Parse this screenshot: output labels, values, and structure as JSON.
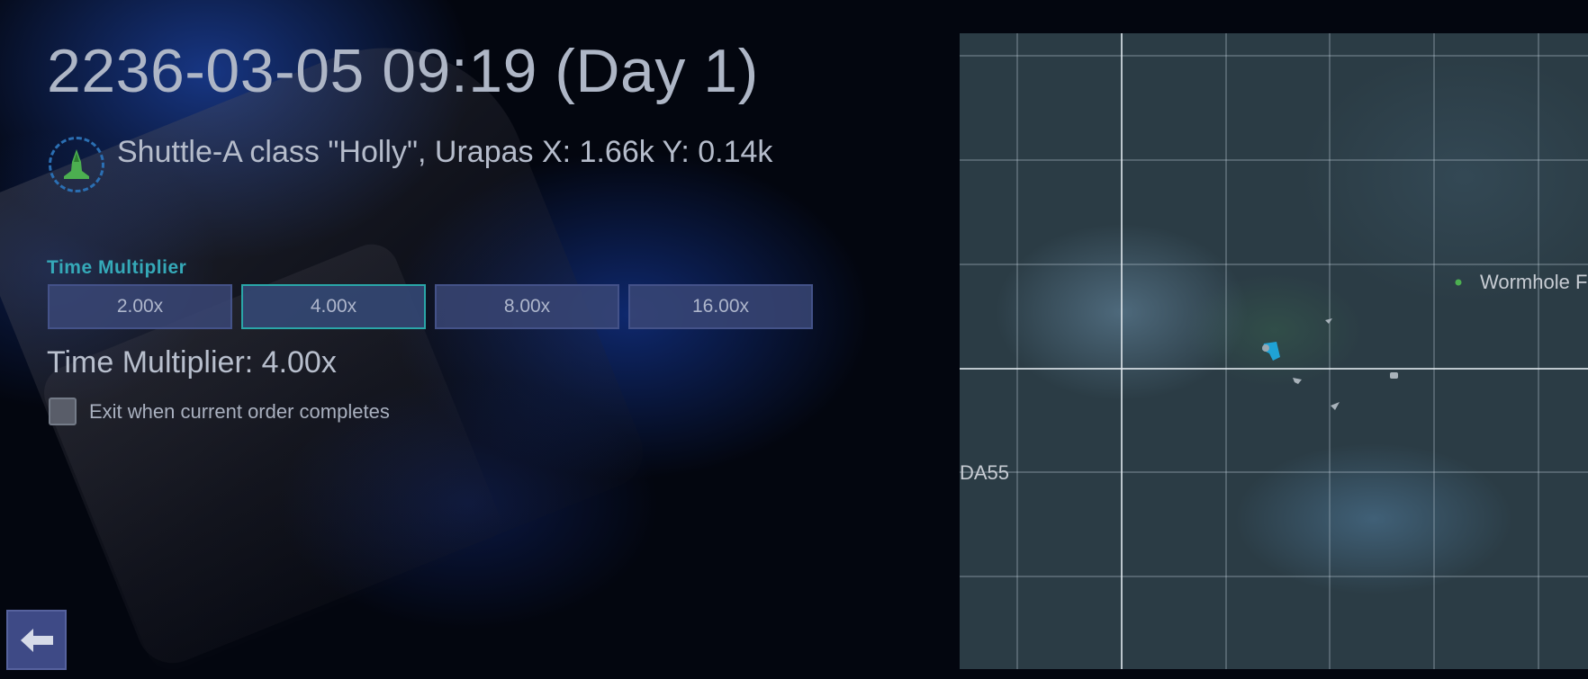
{
  "header": {
    "datetime": "2236-03-05 09:19 (Day 1)"
  },
  "ship": {
    "icon": "shuttle-icon",
    "info": "Shuttle-A class \"Holly\", Urapas X: 1.66k Y: 0.14k"
  },
  "time_multiplier": {
    "section_label": "Time Multiplier",
    "options": [
      "2.00x",
      "4.00x",
      "8.00x",
      "16.00x"
    ],
    "selected_index": 1,
    "current_text": "Time Multiplier: 4.00x"
  },
  "exit_option": {
    "label": "Exit when current order completes",
    "checked": false
  },
  "back_button": {
    "icon": "arrow-left-icon"
  },
  "map": {
    "labels": {
      "wormhole": "Wormhole F",
      "sector": "DA55"
    }
  },
  "colors": {
    "accent_teal": "#35a9b8",
    "button_bg": "#3a4676",
    "back_button_bg": "#3e4a86",
    "player_ship": "#1fa3d6",
    "shuttle_icon": "#4caf50"
  }
}
